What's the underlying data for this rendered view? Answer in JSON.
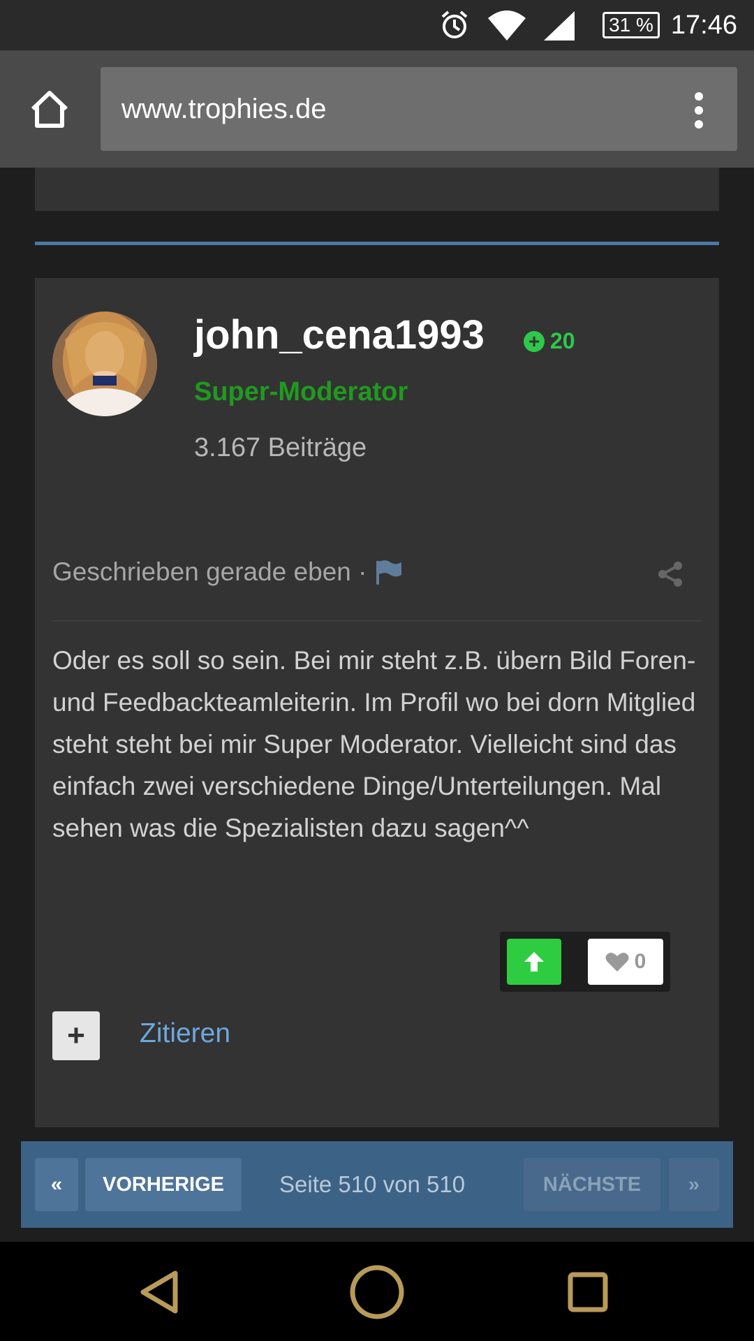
{
  "status_bar": {
    "icons": [
      "alarm-icon",
      "wifi-icon",
      "signal-icon"
    ],
    "battery": "31 %",
    "time": "17:46"
  },
  "browser": {
    "url": "www.trophies.de",
    "icons": [
      "home-icon",
      "overflow-menu-icon"
    ]
  },
  "post": {
    "username": "john_cena1993",
    "reputation": "20",
    "role": "Super-Moderator",
    "post_count": "3.167 Beiträge",
    "meta": "Geschrieben gerade eben ·",
    "body": "Oder es soll so sein. Bei mir steht z.B. übern Bild Foren- und Feedbackteamleiterin. Im Profil wo bei dorn Mitglied steht steht bei mir Super Moderator. Vielleicht sind das einfach zwei verschiedene Dinge/Unterteilungen. Mal sehen was die Spezialisten dazu sagen^^",
    "likes": "0",
    "quote_plus": "+",
    "quote_label": "Zitieren"
  },
  "pagination": {
    "first": "«",
    "prev": "VORHERIGE",
    "info": "Seite 510 von 510",
    "next": "NÄCHSTE",
    "last": "»"
  },
  "colors": {
    "accent_blue": "#4a79a6",
    "reputation_green": "#2ec84b",
    "role_green": "#1f9a1f",
    "link_blue": "#6ea8e0",
    "pager_bg": "#3c6286"
  }
}
